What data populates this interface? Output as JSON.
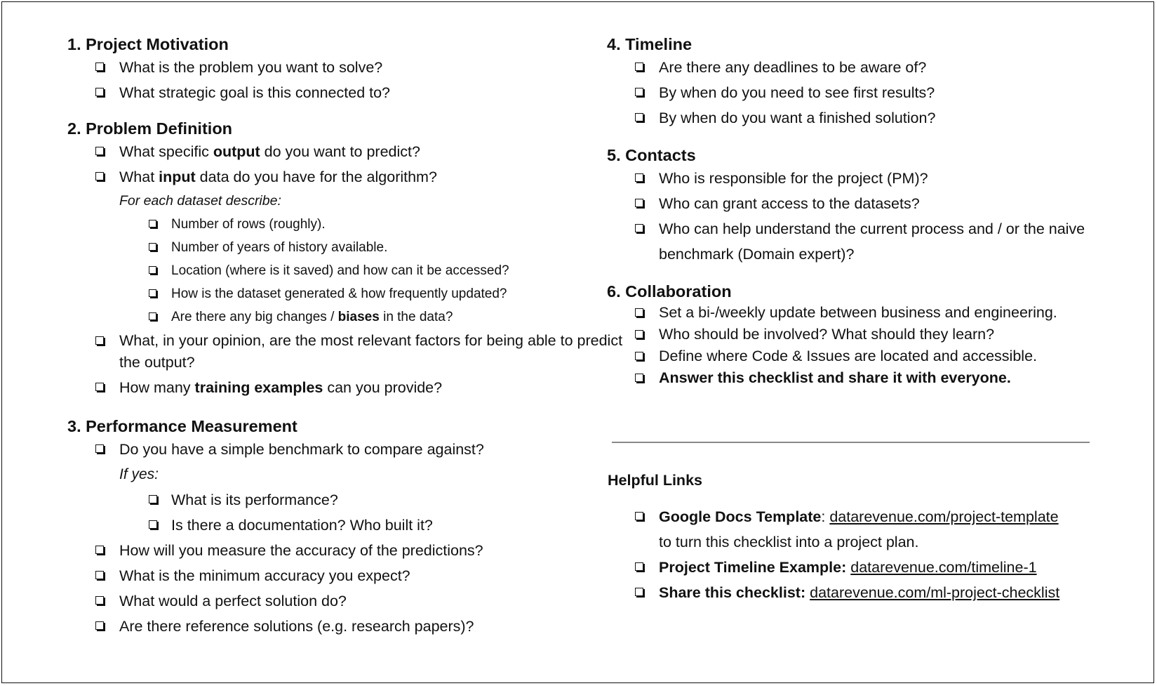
{
  "sections_left": [
    {
      "title": "1. Project Motivation",
      "items": [
        {
          "text": "What is the problem you want to solve?"
        },
        {
          "text": "What strategic goal is this connected to?"
        }
      ]
    },
    {
      "title": "2. Problem Definition",
      "items": [
        {
          "pre": "What specific ",
          "bold": "output",
          "post": " do you want to predict?"
        },
        {
          "pre": "What ",
          "bold": "input",
          "post": " data do you have for the algorithm?"
        }
      ],
      "note": "For each dataset describe:",
      "sub_items": [
        {
          "text": "Number of rows (roughly)."
        },
        {
          "text": "Number of years of history available."
        },
        {
          "text": "Location (where is it saved) and how can it be accessed?"
        },
        {
          "text": "How is the dataset generated & how frequently updated?"
        },
        {
          "pre": "Are there any big changes / ",
          "bold": "biases",
          "post": " in the data?"
        }
      ],
      "more_items": [
        {
          "text": "What, in your opinion, are the most relevant factors for being able to predict the output?"
        },
        {
          "pre": "How many ",
          "bold": "training examples",
          "post": " can you provide?"
        }
      ]
    },
    {
      "title": "3. Performance Measurement",
      "items": [
        {
          "text": "Do you have a simple benchmark to compare against?"
        }
      ],
      "note": "If yes:",
      "sub_items": [
        {
          "text": "What is its performance?"
        },
        {
          "text": "Is there a documentation? Who built it?"
        }
      ],
      "more_items": [
        {
          "text": "How will you measure the accuracy of the predictions?"
        },
        {
          "text": "What is the minimum accuracy you expect?"
        },
        {
          "text": "What would a perfect solution do?"
        },
        {
          "text": "Are there reference solutions (e.g. research papers)?"
        }
      ]
    }
  ],
  "sections_right": [
    {
      "title": "4. Timeline",
      "items": [
        {
          "text": "Are there any deadlines to be aware of?"
        },
        {
          "text": "By when do you need to see first results?"
        },
        {
          "text": "By when do you want a finished solution?"
        }
      ]
    },
    {
      "title": "5. Contacts",
      "items": [
        {
          "text": "Who is responsible for the project (PM)?"
        },
        {
          "text": "Who can grant access to the datasets?"
        },
        {
          "text": "Who can help understand the current process and / or the naive benchmark (Domain expert)?"
        }
      ]
    },
    {
      "title": "6. Collaboration",
      "items": [
        {
          "text": "Set a bi-/weekly update between business and engineering."
        },
        {
          "text": "Who should be involved? What should they learn?"
        },
        {
          "text": "Define where Code & Issues are located and accessible."
        },
        {
          "bold": "Answer this checklist and share it with everyone."
        }
      ]
    }
  ],
  "helpful_links": {
    "title": "Helpful Links",
    "items": [
      {
        "label": "Google Docs Template",
        "sep": ": ",
        "link": "datarevenue.com/project-template",
        "after": "to turn this checklist into a project plan."
      },
      {
        "label": "Project Timeline Example:",
        "sep": " ",
        "link": "datarevenue.com/timeline-1"
      },
      {
        "label": "Share this checklist:",
        "sep": " ",
        "link": "datarevenue.com/ml-project-checklist"
      }
    ]
  }
}
